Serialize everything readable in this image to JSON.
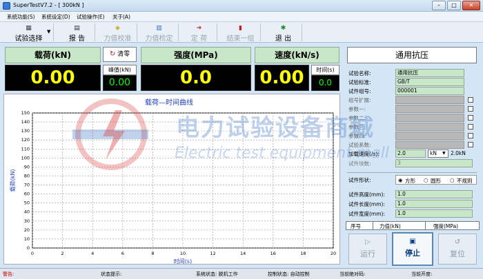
{
  "window": {
    "title": "SuperTestV7.2 - [ 300kN ]",
    "minimize": "–",
    "maximize": "□",
    "close": "✕"
  },
  "menu": [
    "系统功能(S)",
    "系统设定(D)",
    "试验操作(E)",
    "关于(A)"
  ],
  "toolbar": {
    "select_test": "试验选择",
    "report": "报  告",
    "force_calib": "力值校准",
    "force_verify": "力值检定",
    "set": "定  荷",
    "end_group": "结束一组",
    "exit": "退  出"
  },
  "meters": {
    "load": {
      "label": "载荷(kN)",
      "value": "0.00",
      "reset": "清零",
      "peak_label": "峰值(kN)",
      "peak_value": "0.00"
    },
    "strength": {
      "label": "强度(MPa)",
      "value": "0.0"
    },
    "speed": {
      "label": "速度(kN/s)",
      "value": "0.00",
      "time_label": "时间(s)",
      "time_value": "0.0"
    }
  },
  "chart_data": {
    "type": "line",
    "title": "载荷—时间曲线",
    "xlabel": "时间(s)",
    "ylabel": "载荷(kN)",
    "xlim": [
      0,
      20
    ],
    "ylim": [
      0,
      150
    ],
    "xticks": [
      0,
      2,
      4,
      6,
      8,
      10,
      12,
      14,
      16,
      18,
      20
    ],
    "yticks": [
      0,
      10,
      20,
      30,
      40,
      50,
      60,
      70,
      80,
      90,
      100,
      110,
      120,
      130,
      140,
      150
    ],
    "grid": true,
    "series": []
  },
  "right": {
    "title": "通用抗压",
    "fields": [
      {
        "label": "试验名称:",
        "value": "通用抗压",
        "gray": false
      },
      {
        "label": "试验标准:",
        "value": "GB/T",
        "gray": false
      },
      {
        "label": "试件组号:",
        "value": "000001",
        "gray": false
      },
      {
        "label": "组号扩展:",
        "value": "",
        "gray": true
      },
      {
        "label": "参数一:",
        "value": "",
        "gray": true
      },
      {
        "label": "参数二:",
        "value": "",
        "gray": true
      },
      {
        "label": "参数三:",
        "value": "",
        "gray": true
      },
      {
        "label": "参数四:",
        "value": "",
        "gray": true
      },
      {
        "label": "试验系数:",
        "value": "",
        "gray": true
      }
    ],
    "load_speed_label": "加载速度(/s):",
    "load_speed_value": "2.0",
    "load_speed_unit": "kN",
    "load_speed_max": "2.0kN",
    "specimen_count_label": "试件块数:",
    "specimen_count_value": "3",
    "shape_label": "试件形状:",
    "shapes": [
      "方形",
      "圆形",
      "不规则"
    ],
    "dims": [
      {
        "label": "试件高度(mm):",
        "value": "1.0"
      },
      {
        "label": "试件长度(mm):",
        "value": "1.0"
      },
      {
        "label": "试件宽度(mm):",
        "value": "1.0"
      }
    ],
    "table_headers": [
      "序号",
      "力值(kN)",
      "强度(MPa)"
    ],
    "run": "运行",
    "stop": "停止",
    "reset": "复位"
  },
  "status": {
    "alarm": "警告:",
    "hint": "状态提示:",
    "system": "系统状态: 脱机工作",
    "control": "控制状态: 自动控制",
    "cur_code": "当前绝对码:",
    "cur_open": "当前开度:"
  },
  "watermark": {
    "cn": "电力试验设备商城",
    "en": "Electric test equipment mall"
  },
  "colors": {
    "meter_bg": "#000000",
    "meter_text": "#ffff00",
    "peak_text": "#00ff00",
    "header_bg": "#c8e6c8",
    "chart_axis_label": "#2040c0"
  }
}
